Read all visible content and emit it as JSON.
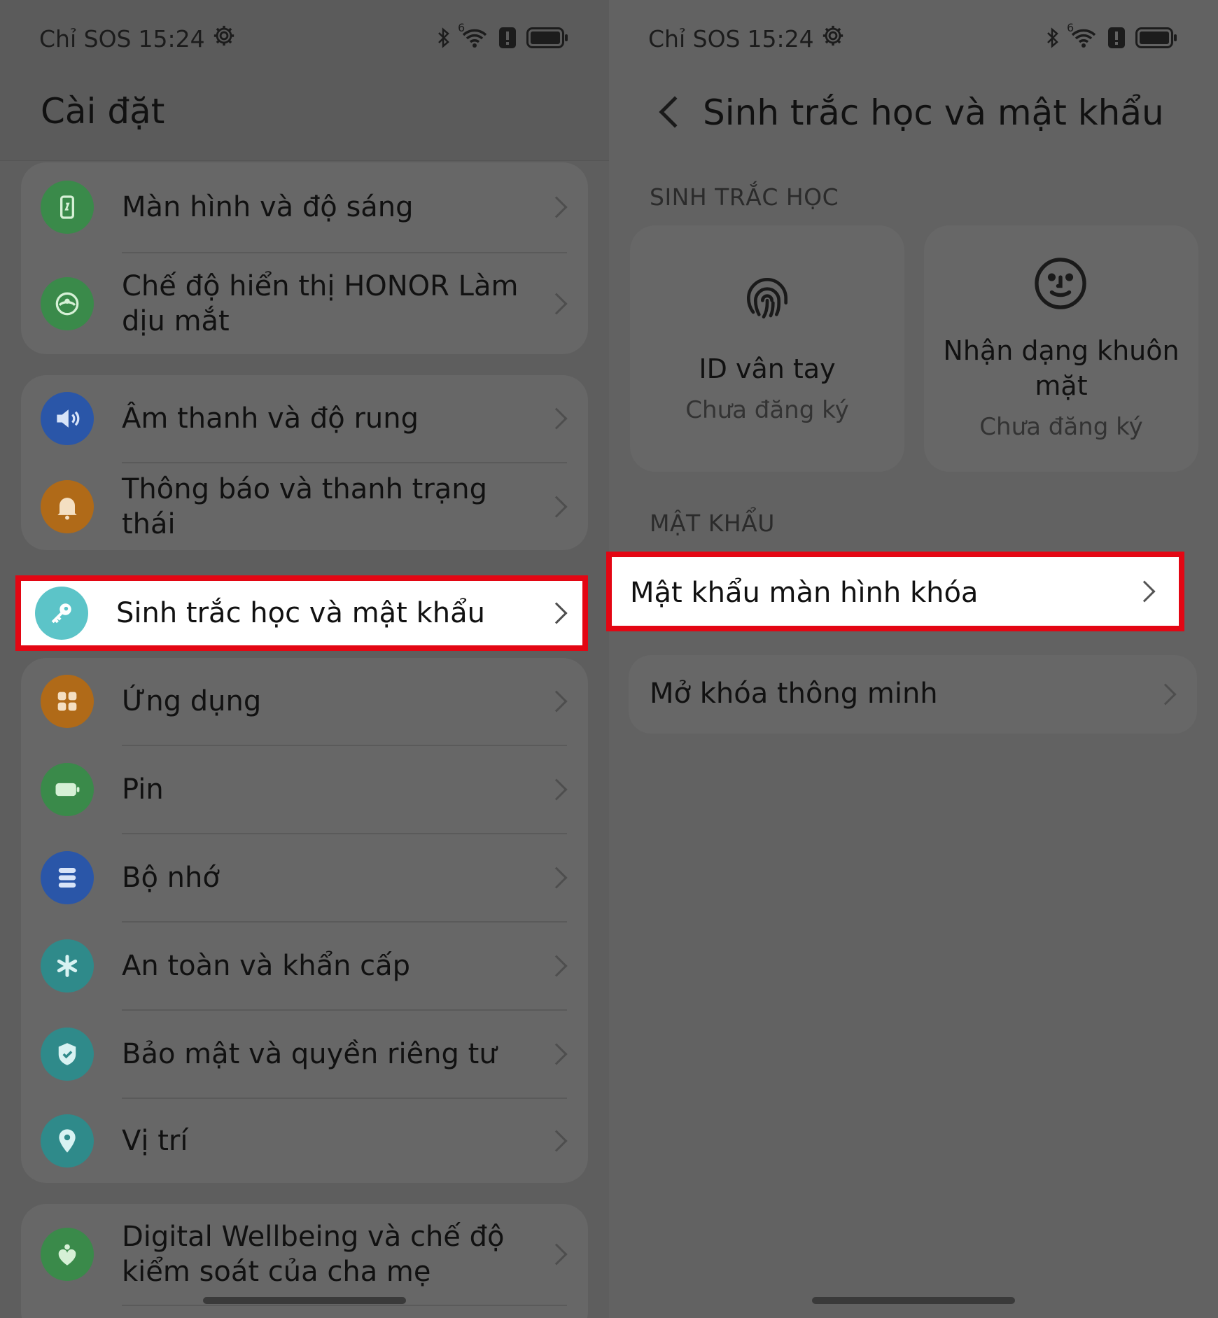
{
  "status_bar": {
    "carrier": "Chỉ SOS",
    "time": "15:24",
    "network_badge": "6"
  },
  "left": {
    "title": "Cài đặt",
    "groups": [
      [
        {
          "label": "Màn hình và độ sáng",
          "icon": "display-icon",
          "color": "#3a8a4a"
        },
        {
          "label": "Chế độ hiển thị HONOR Làm dịu mắt",
          "icon": "eye-comfort-icon",
          "color": "#3a8a4a"
        }
      ],
      [
        {
          "label": "Âm thanh và độ rung",
          "icon": "speaker-icon",
          "color": "#2a56a8"
        },
        {
          "label": "Thông báo và thanh trạng thái",
          "icon": "bell-icon",
          "color": "#b06a18"
        }
      ],
      [
        {
          "label": "Sinh trắc học và mật khẩu",
          "icon": "key-icon",
          "color": "#5cc4c8",
          "highlighted": true
        }
      ],
      [
        {
          "label": "Ứng dụng",
          "icon": "apps-icon",
          "color": "#b06a18"
        },
        {
          "label": "Pin",
          "icon": "battery-icon",
          "color": "#3a8a4a"
        },
        {
          "label": "Bộ nhớ",
          "icon": "storage-icon",
          "color": "#2a56a8"
        },
        {
          "label": "An toàn và khẩn cấp",
          "icon": "asterisk-icon",
          "color": "#2f8a8a"
        },
        {
          "label": "Bảo mật và quyền riêng tư",
          "icon": "shield-icon",
          "color": "#2f8a8a"
        },
        {
          "label": "Vị trí",
          "icon": "location-pin-icon",
          "color": "#2f8a8a"
        }
      ],
      [
        {
          "label": "Digital Wellbeing và chế độ kiểm soát của cha mẹ",
          "icon": "wellbeing-heart-icon",
          "color": "#3a8a4a"
        }
      ]
    ]
  },
  "right": {
    "title": "Sinh trắc học và mật khẩu",
    "biometrics_label": "SINH TRẮC HỌC",
    "fingerprint": {
      "title": "ID vân tay",
      "status": "Chưa đăng ký"
    },
    "face": {
      "title": "Nhận dạng khuôn mặt",
      "status": "Chưa đăng ký"
    },
    "password_label": "MẬT KHẨU",
    "lock_password": "Mật khẩu màn hình khóa",
    "smart_unlock": "Mở khóa thông minh"
  },
  "colors": {
    "highlight_border": "#e30613"
  }
}
